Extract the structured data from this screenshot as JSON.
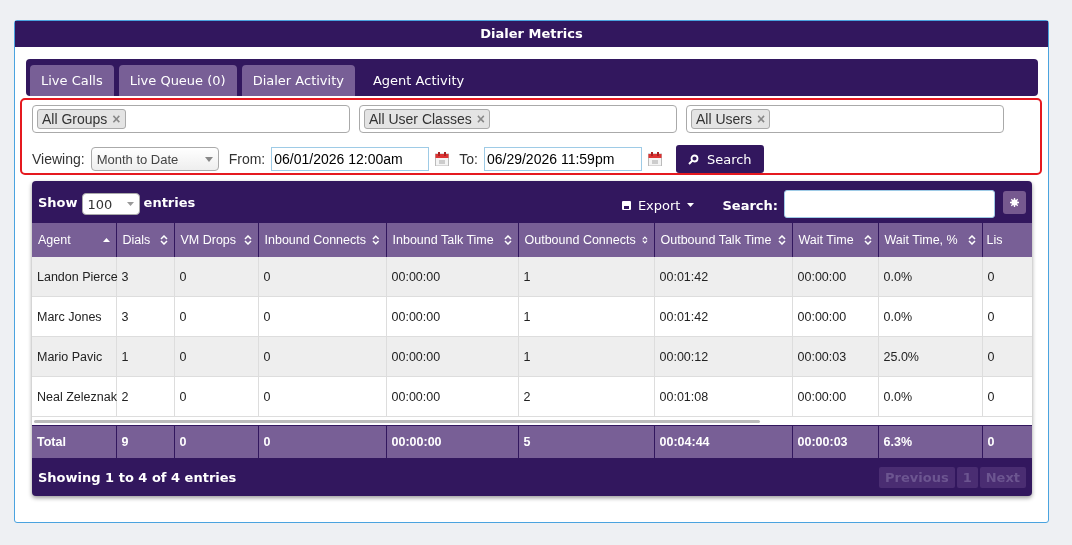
{
  "window": {
    "title": "Dialer Metrics"
  },
  "tabs": [
    {
      "label": "Live Calls",
      "selected": false
    },
    {
      "label": "Live Queue (0)",
      "selected": false
    },
    {
      "label": "Dialer Activity",
      "selected": false
    },
    {
      "label": "Agent Activity",
      "selected": true
    }
  ],
  "filters": {
    "tag_fields": [
      {
        "tag": "All Groups",
        "remove": "×"
      },
      {
        "tag": "All User Classes",
        "remove": "×"
      },
      {
        "tag": "All Users",
        "remove": "×"
      }
    ],
    "viewing_label": "Viewing:",
    "viewing_value": "Month to Date",
    "from_label": "From:",
    "from_value": "06/01/2026 12:00am",
    "to_label": "To:",
    "to_value": "06/29/2026 11:59pm",
    "search_button": "Search"
  },
  "table_controls": {
    "show_label": "Show",
    "page_size": "100",
    "entries_label": "entries",
    "export_button": "Export",
    "search_label": "Search:"
  },
  "table": {
    "columns": [
      {
        "label": "Agent",
        "sorted": true
      },
      {
        "label": "Dials",
        "sorted": false
      },
      {
        "label": "VM Drops",
        "sorted": false
      },
      {
        "label": "Inbound Connects",
        "sorted": false
      },
      {
        "label": "Inbound Talk Time",
        "sorted": false
      },
      {
        "label": "Outbound Connects",
        "sorted": false
      },
      {
        "label": "Outbound Talk Time",
        "sorted": false
      },
      {
        "label": "Wait Time",
        "sorted": false
      },
      {
        "label": "Wait Time, %",
        "sorted": false
      },
      {
        "label": "Lis"
      }
    ],
    "rows": [
      [
        "Landon Pierce",
        "3",
        "0",
        "0",
        "00:00:00",
        "1",
        "00:01:42",
        "00:00:00",
        "0.0%",
        "0"
      ],
      [
        "Marc Jones",
        "3",
        "0",
        "0",
        "00:00:00",
        "1",
        "00:01:42",
        "00:00:00",
        "0.0%",
        "0"
      ],
      [
        "Mario Pavic",
        "1",
        "0",
        "0",
        "00:00:00",
        "1",
        "00:00:12",
        "00:00:03",
        "25.0%",
        "0"
      ],
      [
        "Neal Zeleznak",
        "2",
        "0",
        "0",
        "00:00:00",
        "2",
        "00:01:08",
        "00:00:00",
        "0.0%",
        "0"
      ]
    ],
    "totals": [
      "Total",
      "9",
      "0",
      "0",
      "00:00:00",
      "5",
      "00:04:44",
      "00:00:03",
      "6.3%",
      "0"
    ]
  },
  "footer": {
    "info": "Showing 1 to 4 of 4 entries",
    "pagination": [
      {
        "label": "Previous",
        "disabled": true
      },
      {
        "label": "1",
        "disabled": true
      },
      {
        "label": "Next",
        "disabled": true
      }
    ]
  }
}
